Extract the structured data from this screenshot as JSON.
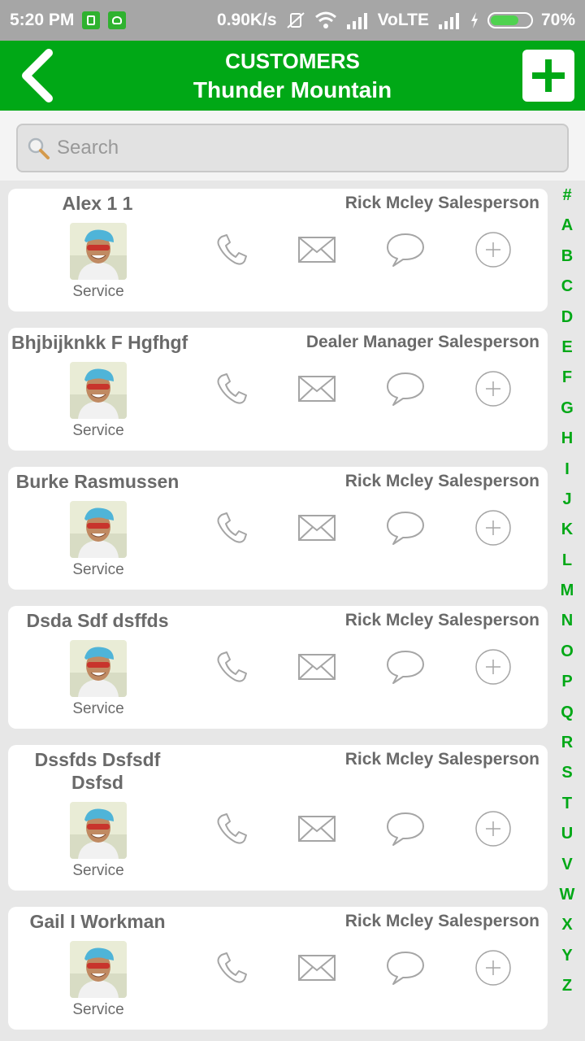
{
  "status_bar": {
    "time": "5:20 PM",
    "speed": "0.90K/s",
    "network": "VoLTE",
    "battery_pct": "70%",
    "battery_level": 0.7
  },
  "header": {
    "title": "CUSTOMERS",
    "subtitle": "Thunder Mountain",
    "accent_color": "#00a816"
  },
  "search": {
    "placeholder": "Search"
  },
  "customers": [
    {
      "name": "Alex 1 1",
      "salesperson": "Rick Mcley Salesperson",
      "department": "Service"
    },
    {
      "name": "Bhjbijknkk F Hgfhgf",
      "salesperson": "Dealer Manager Salesperson",
      "department": "Service"
    },
    {
      "name": "Burke Rasmussen",
      "salesperson": "Rick Mcley Salesperson",
      "department": "Service"
    },
    {
      "name": "Dsda Sdf dsffds",
      "salesperson": "Rick Mcley Salesperson",
      "department": "Service"
    },
    {
      "name": "Dssfds Dsfsdf Dsfsd",
      "salesperson": "Rick Mcley Salesperson",
      "department": "Service"
    },
    {
      "name": "Gail I Workman",
      "salesperson": "Rick Mcley Salesperson",
      "department": "Service"
    }
  ],
  "action_icons": [
    "phone-icon",
    "mail-icon",
    "chat-icon",
    "add-circle-icon"
  ],
  "alphabet": [
    "#",
    "A",
    "B",
    "C",
    "D",
    "E",
    "F",
    "G",
    "H",
    "I",
    "J",
    "K",
    "L",
    "M",
    "N",
    "O",
    "P",
    "Q",
    "R",
    "S",
    "T",
    "U",
    "V",
    "W",
    "X",
    "Y",
    "Z"
  ]
}
